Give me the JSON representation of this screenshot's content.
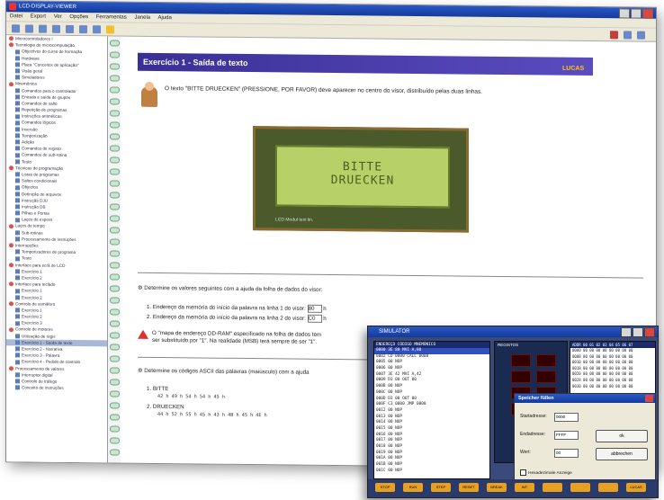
{
  "window": {
    "title": "LCD-DISPLAY-VIEWER",
    "menu": [
      "Datei",
      "Export",
      "Ver",
      "Opções",
      "Ferramentas",
      "Janela",
      "Ajuda"
    ]
  },
  "tree": [
    {
      "label": "Microcontroladores I",
      "type": "f"
    },
    {
      "label": "Tecnologia de microcomputação",
      "type": "f"
    },
    {
      "label": "Objectivos do curso de formação",
      "type": "d"
    },
    {
      "label": "Hardware",
      "type": "d"
    },
    {
      "label": "Placa \"Conceitos de aplicação\"",
      "type": "d"
    },
    {
      "label": "Visão geral",
      "type": "d"
    },
    {
      "label": "Simuladores",
      "type": "d"
    },
    {
      "label": "Mnemónica",
      "type": "f"
    },
    {
      "label": "Comandos para o controlador",
      "type": "d"
    },
    {
      "label": "Entrada e saída de grupos",
      "type": "d"
    },
    {
      "label": "Comandos de salto",
      "type": "d"
    },
    {
      "label": "Repetição de programas",
      "type": "d"
    },
    {
      "label": "Instruções aritméticas",
      "type": "d"
    },
    {
      "label": "Comandos lógicos",
      "type": "d"
    },
    {
      "label": "Inversão",
      "type": "d"
    },
    {
      "label": "Temporização",
      "type": "d"
    },
    {
      "label": "Adição",
      "type": "d"
    },
    {
      "label": "Comandos de registo",
      "type": "d"
    },
    {
      "label": "Comandos de sub-rotina",
      "type": "d"
    },
    {
      "label": "Testo",
      "type": "d"
    },
    {
      "label": "Técnicas de programação",
      "type": "f"
    },
    {
      "label": "Listas de programas",
      "type": "d"
    },
    {
      "label": "Saltos condicionais",
      "type": "d"
    },
    {
      "label": "Objectos",
      "type": "d"
    },
    {
      "label": "Definição de arquivos",
      "type": "d"
    },
    {
      "label": "Instrução DJU",
      "type": "d"
    },
    {
      "label": "Instrução DB",
      "type": "d"
    },
    {
      "label": "Pilhas e Portas",
      "type": "d"
    },
    {
      "label": "Laços de espera",
      "type": "d"
    },
    {
      "label": "Laços de tempo",
      "type": "f"
    },
    {
      "label": "Sub-rotinas",
      "type": "d"
    },
    {
      "label": "Processamento de instruções",
      "type": "d"
    },
    {
      "label": "Interrupções",
      "type": "f"
    },
    {
      "label": "Temporizadores de programa",
      "type": "d"
    },
    {
      "label": "Testo",
      "type": "d"
    },
    {
      "label": "Interface para ecrã de LCD",
      "type": "f"
    },
    {
      "label": "Exercício 1",
      "type": "d"
    },
    {
      "label": "Exercício 2",
      "type": "d"
    },
    {
      "label": "Interface para teclado",
      "type": "f"
    },
    {
      "label": "Exercício 1",
      "type": "d"
    },
    {
      "label": "Exercício 2",
      "type": "d"
    },
    {
      "label": "Controlo de semáforo",
      "type": "f"
    },
    {
      "label": "Exercício 1",
      "type": "d"
    },
    {
      "label": "Exercício 2",
      "type": "d"
    },
    {
      "label": "Exercício 3",
      "type": "d"
    },
    {
      "label": "Controlo de motores",
      "type": "f"
    },
    {
      "label": "Utilização de regis",
      "type": "d"
    },
    {
      "label": "Exercício 1 - Saída de texto",
      "type": "d",
      "highlight": true
    },
    {
      "label": "Exercício 2 - Narrativa",
      "type": "d"
    },
    {
      "label": "Exercício 3 - Palavra",
      "type": "d"
    },
    {
      "label": "Exercício 4 - Pedido de controlo",
      "type": "d"
    },
    {
      "label": "Processamento de valores",
      "type": "f"
    },
    {
      "label": "Interruptor digital",
      "type": "d"
    },
    {
      "label": "Controlo de tráfego",
      "type": "d"
    },
    {
      "label": "Conceito de instruções",
      "type": "d"
    }
  ],
  "content": {
    "heading": "Exercício 1 - Saída de texto",
    "logo": "LUCAS",
    "intro": "O texto \"BITTE DRUECKEN\" (PRESSIONE, POR FAVOR) deve aparecer no centro do visor, distribuído pelas duas linhas.",
    "lcd_line1": "BITTE",
    "lcd_line2": "DRUECKEN",
    "lcd_board_label": "LCD Modul     text lin.",
    "q1": "Determine os valores seguintes com a ajuda da folha de dados do visor:",
    "q1_a": "1.  Endereço da memória do início da palavra na linha 1 do visor:",
    "q1_a_value": "80",
    "q1_a_suffix": "h",
    "q1_b": "2.  Endereço da memória do início da palavra na linha 2 do visor:",
    "q1_b_value": "C0",
    "q1_b_suffix": "h",
    "warn": "O \"mapa de endereço DD-RAM\" especificado na folha de dados tem",
    "warn2": "ser substituído por \"1\". Na realidade (MSB) terá sempre de ser \"1\".",
    "q2": "Determine os códigos ASCII das palavras (maiúsculo) com a ajuda",
    "code1_label": "1.  BITTE",
    "code1": "42  h 49  h 54  h 54  h 45  h",
    "code2_label": "2.  DRUECKEN",
    "code2": "44  h 52  h 55  h 45  h 43  h 4B  h 45  h 4E  h"
  },
  "sim": {
    "title": "SIMULATOR",
    "mem_header": "ENDEREÇO  CÓDIGO     MNEMÓNICO",
    "mem_rows": [
      "0000  3E 80  MVI  A,80",
      "0002  CD 0000  CALL  0008",
      "0005  00       NOP",
      "0006  00       NOP",
      "0007  3E 42  MVI  A,42",
      "0009  D3 00  OUT  00",
      "000B  00       NOP",
      "000C  00       NOP",
      "000D  D3 00  OUT  00",
      "000F  C3 0000  JMP  0000",
      "0012  00       NOP",
      "0013  00       NOP",
      "0014  00       NOP",
      "0015  00       NOP",
      "0016  00       NOP",
      "0017  00       NOP",
      "0018  00       NOP",
      "0019  00       NOP",
      "001A  00       NOP",
      "001B  00       NOP",
      "001C  00       NOP"
    ],
    "reg_header": "REGISTOS",
    "dump_header": "ADDR  00 01 02 03 04 05 06 07",
    "dump_rows": [
      "0000  00 00 00 00 00 00 00 00",
      "0008  00 00 00 00 00 00 00 00",
      "0010  00 00 00 00 00 00 00 00",
      "0018  00 00 00 00 00 00 00 00",
      "0020  00 00 00 00 00 00 00 00",
      "0028  00 00 00 00 00 00 00 00",
      "0030  00 00 00 00 00 00 00 00"
    ],
    "dialog": {
      "title": "Speicher füllen",
      "field1_label": "Startadresse:",
      "field1_value": "0000",
      "field2_label": "Endadresse:",
      "field2_value": "FFFF",
      "field3_label": "Wert:",
      "field3_value": "00",
      "ok": "ok",
      "cancel": "abbrechen",
      "check": "Hexadezimale Anzeige"
    },
    "bottom": [
      "STOP",
      "RUN",
      "STEP",
      "RESET",
      "BREAK",
      "INT",
      "",
      "",
      "",
      "LUCAS"
    ]
  }
}
